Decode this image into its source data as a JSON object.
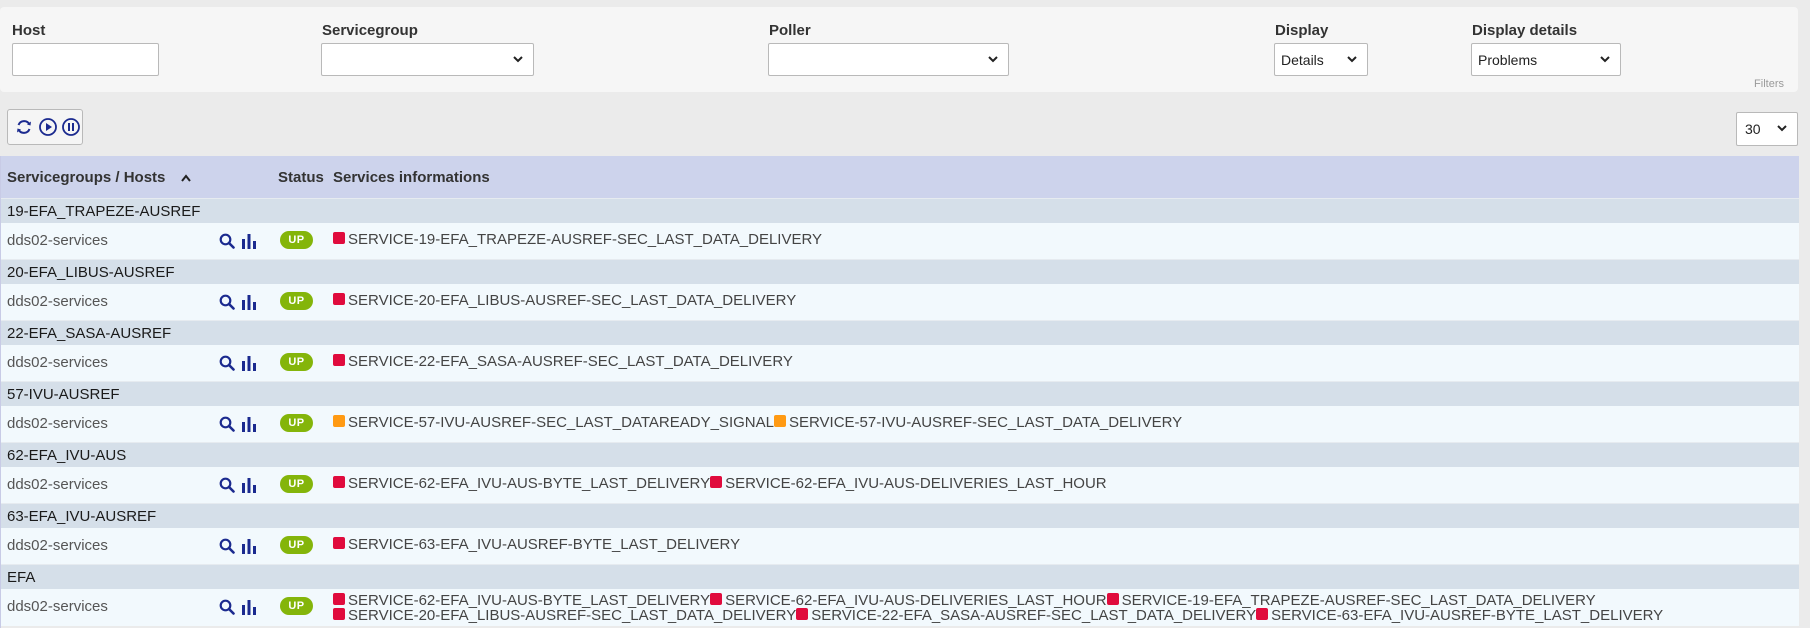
{
  "filters": {
    "host": {
      "label": "Host",
      "value": "",
      "placeholder": ""
    },
    "servicegroup": {
      "label": "Servicegroup",
      "value": ""
    },
    "poller": {
      "label": "Poller",
      "value": ""
    },
    "display": {
      "label": "Display",
      "value": "Details"
    },
    "display_details": {
      "label": "Display details",
      "value": "Problems"
    },
    "caption": "Filters"
  },
  "toolbar": {
    "buttons": [
      "refresh-icon",
      "play-icon",
      "pause-icon"
    ],
    "limit": "30"
  },
  "colors": {
    "critical": "#e00b3d",
    "warning": "#ff9a13",
    "up": "#84b50a",
    "header_bg": "#cdd3ec"
  },
  "table": {
    "headers": {
      "servicegroups_hosts": "Servicegroups / Hosts",
      "status": "Status",
      "services": "Services informations"
    },
    "groups": [
      {
        "name": "19-EFA_TRAPEZE-AUSREF",
        "host": "dds02-services",
        "status": "UP",
        "services": [
          {
            "name": "SERVICE-19-EFA_TRAPEZE-AUSREF-SEC_LAST_DATA_DELIVERY",
            "state": "critical"
          }
        ]
      },
      {
        "name": "20-EFA_LIBUS-AUSREF",
        "host": "dds02-services",
        "status": "UP",
        "services": [
          {
            "name": "SERVICE-20-EFA_LIBUS-AUSREF-SEC_LAST_DATA_DELIVERY",
            "state": "critical"
          }
        ]
      },
      {
        "name": "22-EFA_SASA-AUSREF",
        "host": "dds02-services",
        "status": "UP",
        "services": [
          {
            "name": "SERVICE-22-EFA_SASA-AUSREF-SEC_LAST_DATA_DELIVERY",
            "state": "critical"
          }
        ]
      },
      {
        "name": "57-IVU-AUSREF",
        "host": "dds02-services",
        "status": "UP",
        "services": [
          {
            "name": "SERVICE-57-IVU-AUSREF-SEC_LAST_DATAREADY_SIGNAL",
            "state": "warning"
          },
          {
            "name": "SERVICE-57-IVU-AUSREF-SEC_LAST_DATA_DELIVERY",
            "state": "warning"
          }
        ]
      },
      {
        "name": "62-EFA_IVU-AUS",
        "host": "dds02-services",
        "status": "UP",
        "services": [
          {
            "name": "SERVICE-62-EFA_IVU-AUS-BYTE_LAST_DELIVERY",
            "state": "critical"
          },
          {
            "name": "SERVICE-62-EFA_IVU-AUS-DELIVERIES_LAST_HOUR",
            "state": "critical"
          }
        ]
      },
      {
        "name": "63-EFA_IVU-AUSREF",
        "host": "dds02-services",
        "status": "UP",
        "services": [
          {
            "name": "SERVICE-63-EFA_IVU-AUSREF-BYTE_LAST_DELIVERY",
            "state": "critical"
          }
        ]
      },
      {
        "name": "EFA",
        "host": "dds02-services",
        "status": "UP",
        "services": [
          {
            "name": "SERVICE-62-EFA_IVU-AUS-BYTE_LAST_DELIVERY",
            "state": "critical"
          },
          {
            "name": "SERVICE-62-EFA_IVU-AUS-DELIVERIES_LAST_HOUR",
            "state": "critical"
          },
          {
            "name": "SERVICE-19-EFA_TRAPEZE-AUSREF-SEC_LAST_DATA_DELIVERY",
            "state": "critical"
          },
          {
            "name": "SERVICE-20-EFA_LIBUS-AUSREF-SEC_LAST_DATA_DELIVERY",
            "state": "critical"
          },
          {
            "name": "SERVICE-22-EFA_SASA-AUSREF-SEC_LAST_DATA_DELIVERY",
            "state": "critical"
          },
          {
            "name": "SERVICE-63-EFA_IVU-AUSREF-BYTE_LAST_DELIVERY",
            "state": "critical"
          }
        ]
      }
    ]
  }
}
